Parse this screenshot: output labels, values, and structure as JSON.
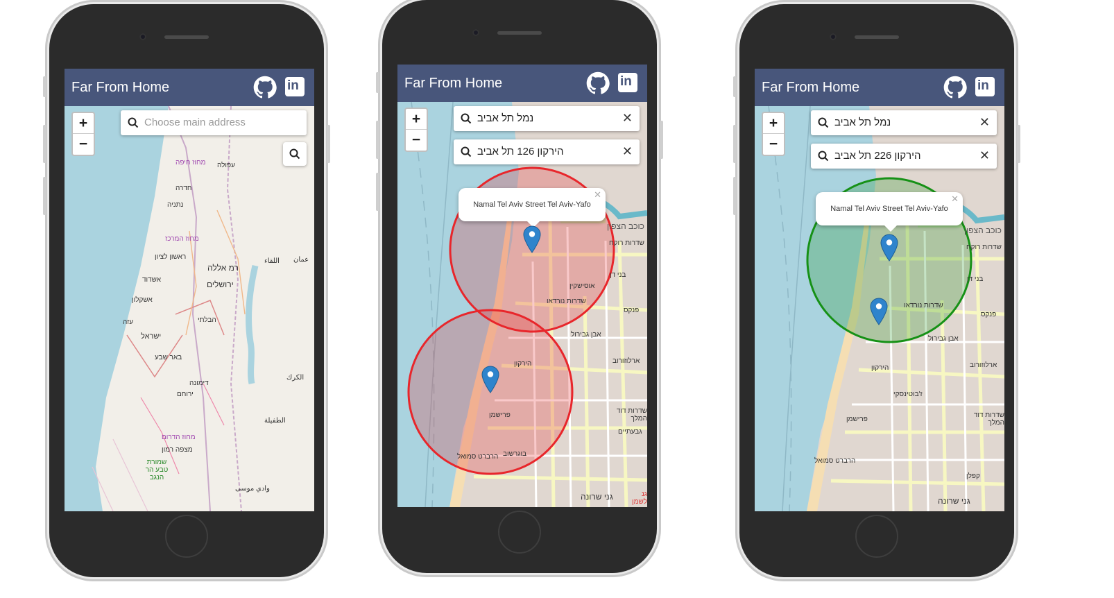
{
  "app": {
    "title": "Far From Home"
  },
  "colors": {
    "header": "#48567b",
    "water": "#aad3df",
    "land": "#f2efe9",
    "red_circle": "#e8262b",
    "green_circle": "#169116"
  },
  "icons": [
    "github-icon",
    "linkedin-icon",
    "search-icon",
    "close-icon",
    "map-pin-icon",
    "zoom-in-icon",
    "zoom-out-icon"
  ],
  "zoom": {
    "in": "+",
    "out": "−"
  },
  "screens": [
    {
      "search_placeholder": "Choose main address",
      "labels": [
        "מחוז חיפה",
        "עפולה",
        "חדרה",
        "נתניה",
        "מחוז המרכז",
        "ראשון לציון",
        "אשדוד",
        "רמ אללה",
        "ירושלים",
        "אשקלון",
        "עזה",
        "הבלתי",
        "ישראל",
        "באר שבע",
        "דימונה",
        "ירוחם",
        "מחוז הדרום",
        "מצפה רמון",
        "שמורת טבע הר הנגב",
        "الكرك",
        "الطفيلة",
        "وادي موسى",
        "عمان",
        "اللقاء"
      ]
    },
    {
      "search1": "נמל תל אביב",
      "search2": "הירקון 126 תל אביב",
      "popup": "Namal Tel Aviv Street Tel Aviv-Yafo",
      "labels": [
        "כוכב הצפון",
        "שדרות רוקח",
        "בני דן",
        "אוסישקין",
        "שדרות נורדאו",
        "פנקס",
        "ארלוזורוב",
        "פרישמן",
        "בוגרשוב",
        "שדרות דוד המלך",
        "גבעתיים",
        "גנ לשמן",
        "אבן גבירול",
        "הירקון",
        "הרברט סמואל",
        "גני שרונה"
      ]
    },
    {
      "search1": "נמל תל אביב",
      "search2": "הירקון 226 תל אביב",
      "popup": "Namal Tel Aviv Street Tel Aviv-Yafo",
      "labels": [
        "כוכב הצפון",
        "שדרות רוקח",
        "בני דן",
        "שדרות נורדאו",
        "פנקס",
        "ארלוזורוב",
        "פרישמן",
        "שדרות דוד המלך",
        "הירקון",
        "הרברט סמואל",
        "גני שרונה",
        "אבן גבירול",
        "ז'בוטינסקי",
        "קפלן"
      ]
    }
  ]
}
